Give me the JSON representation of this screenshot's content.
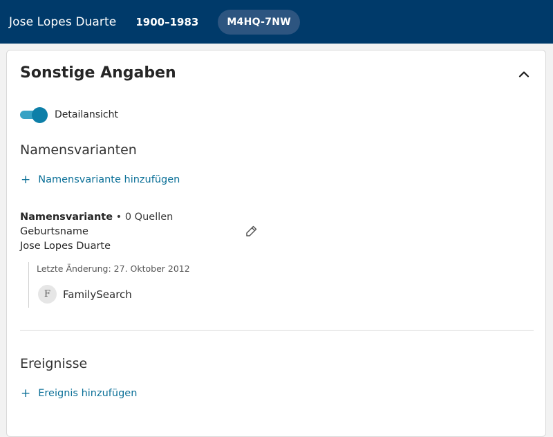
{
  "header": {
    "person_name": "Jose Lopes Duarte",
    "lifespan": "1900–1983",
    "person_id": "M4HQ-7NW"
  },
  "card": {
    "title": "Sonstige Angaben",
    "collapse_icon": "chevron-up-icon",
    "detail_toggle": {
      "label": "Detailansicht",
      "on": true
    }
  },
  "name_variants": {
    "heading": "Namensvarianten",
    "add_label": "Namensvariante hinzufügen",
    "entries": [
      {
        "type_label": "Namensvariante",
        "sources": "• 0 Quellen",
        "subtype": "Geburtsname",
        "value": "Jose Lopes Duarte",
        "last_changed": "Letzte Änderung: 27. Oktober 2012",
        "contributor_initial": "F",
        "contributor": "FamilySearch"
      }
    ]
  },
  "events": {
    "heading": "Ereignisse",
    "add_label": "Ereignis hinzufügen"
  },
  "colors": {
    "header_bg": "#003a6a",
    "link": "#0a6f97",
    "toggle": "#0d7fa8"
  }
}
